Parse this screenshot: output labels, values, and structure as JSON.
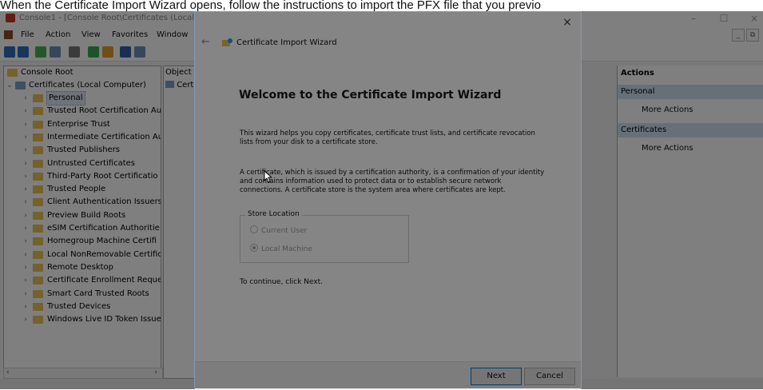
{
  "caption": "When the Certificate Import Wizard opens, follow the instructions to import the PFX file that you previo",
  "mmc": {
    "title": "Console1 - [Console Root\\Certificates (Local",
    "menu": [
      "File",
      "Action",
      "View",
      "Favorites",
      "Window"
    ],
    "tree": {
      "root": "Console Root",
      "computer": "Certificates (Local Computer)",
      "stores": [
        "Personal",
        "Trusted Root Certification Au",
        "Enterprise Trust",
        "Intermediate Certification Au",
        "Trusted Publishers",
        "Untrusted Certificates",
        "Third-Party Root Certificatio",
        "Trusted People",
        "Client Authentication Issuers",
        "Preview Build Roots",
        "eSIM Certification Authoritie",
        "Homegroup Machine Certifi",
        "Local NonRemovable Certific",
        "Remote Desktop",
        "Certificate Enrollment Reque",
        "Smart Card Trusted Roots",
        "Trusted Devices",
        "Windows Live ID Token Issue"
      ]
    },
    "center": {
      "header": "Object",
      "item": "Cert"
    },
    "actions": {
      "header": "Actions",
      "sections": [
        {
          "title": "Personal",
          "item": "More Actions"
        },
        {
          "title": "Certificates",
          "item": "More Actions"
        }
      ]
    }
  },
  "wizard": {
    "window_title": "Certificate Import Wizard",
    "heading": "Welcome to the Certificate Import Wizard",
    "intro_line1": "This wizard helps you copy certificates, certificate trust lists, and certificate revocation",
    "intro_line2": "lists from your disk to a certificate store.",
    "desc_line1": "A certificate, which is issued by a certification authority, is a confirmation of your identity",
    "desc_line2": "and contains information used to protect data or to establish secure network",
    "desc_line3": "connections. A certificate store is the system area where certificates are kept.",
    "store_location_label": "Store Location",
    "options": [
      {
        "label": "Current User",
        "selected": false
      },
      {
        "label": "Local Machine",
        "selected": true
      }
    ],
    "continue_text": "To continue, click Next.",
    "next_label": "Next",
    "cancel_label": "Cancel",
    "close_glyph": "×",
    "back_glyph": "←"
  },
  "window_glyphs": {
    "minimize": "–",
    "maximize": "☐",
    "close": "×",
    "mdi_min": "_",
    "mdi_restore": "⧉",
    "tree_collapse": "‹",
    "tree_expand": "›"
  }
}
